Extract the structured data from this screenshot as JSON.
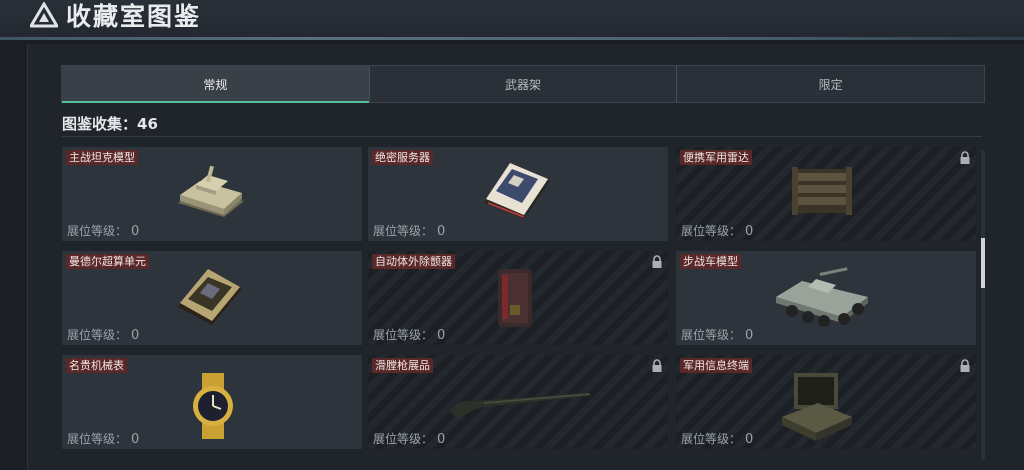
{
  "header": {
    "title": "收藏室图鉴",
    "icon": "triangle-logo-icon"
  },
  "tabs": [
    {
      "label": "常规",
      "active": true
    },
    {
      "label": "武器架",
      "active": false
    },
    {
      "label": "限定",
      "active": false
    }
  ],
  "collection": {
    "label": "图鉴收集：46"
  },
  "level_label": "展位等级：",
  "cards": [
    {
      "name": "主战坦克模型",
      "level": "0",
      "locked": false,
      "icon": "tank-icon"
    },
    {
      "name": "绝密服务器",
      "level": "0",
      "locked": false,
      "icon": "server-icon"
    },
    {
      "name": "便携军用雷达",
      "level": "0",
      "locked": true,
      "icon": "radar-icon"
    },
    {
      "name": "曼德尔超算单元",
      "level": "0",
      "locked": false,
      "icon": "supercomputer-icon"
    },
    {
      "name": "自动体外除颤器",
      "level": "0",
      "locked": true,
      "icon": "defibrillator-icon"
    },
    {
      "name": "步战车模型",
      "level": "0",
      "locked": false,
      "icon": "ifv-icon"
    },
    {
      "name": "名贵机械表",
      "level": "0",
      "locked": false,
      "icon": "watch-icon"
    },
    {
      "name": "滑膛枪展品",
      "level": "0",
      "locked": true,
      "icon": "musket-icon"
    },
    {
      "name": "军用信息终端",
      "level": "0",
      "locked": true,
      "icon": "terminal-icon"
    }
  ],
  "colors": {
    "accent": "#55c19a",
    "label_bg": "#5a2828",
    "card_bg": "#2e343b"
  }
}
